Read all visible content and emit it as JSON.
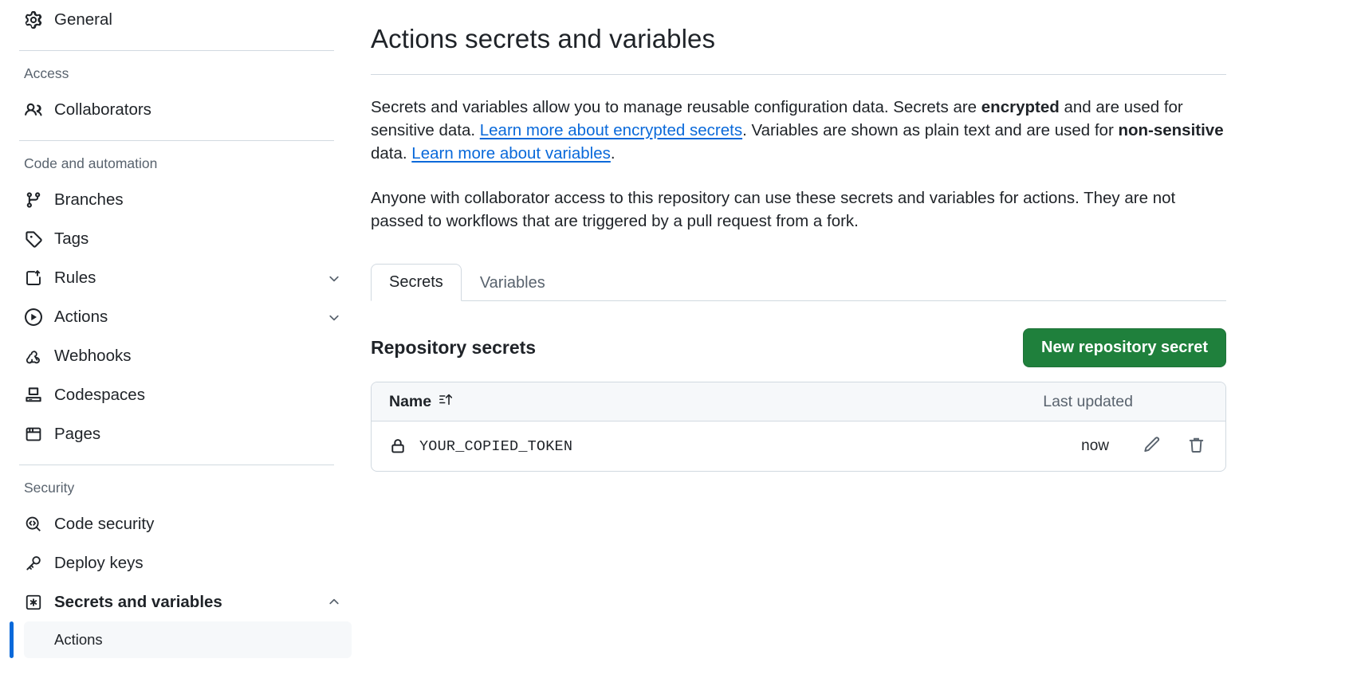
{
  "sidebar": {
    "top_items": [
      {
        "label": "General",
        "icon": "gear-icon"
      }
    ],
    "groups": [
      {
        "title": "Access",
        "items": [
          {
            "label": "Collaborators",
            "icon": "people-icon",
            "chevron": ""
          }
        ]
      },
      {
        "title": "Code and automation",
        "items": [
          {
            "label": "Branches",
            "icon": "git-branch-icon",
            "chevron": ""
          },
          {
            "label": "Tags",
            "icon": "tag-icon",
            "chevron": ""
          },
          {
            "label": "Rules",
            "icon": "rules-icon",
            "chevron": "down"
          },
          {
            "label": "Actions",
            "icon": "play-circle-icon",
            "chevron": "down"
          },
          {
            "label": "Webhooks",
            "icon": "webhook-icon",
            "chevron": ""
          },
          {
            "label": "Codespaces",
            "icon": "codespaces-icon",
            "chevron": ""
          },
          {
            "label": "Pages",
            "icon": "browser-icon",
            "chevron": ""
          }
        ]
      },
      {
        "title": "Security",
        "items": [
          {
            "label": "Code security",
            "icon": "code-scan-icon",
            "chevron": ""
          },
          {
            "label": "Deploy keys",
            "icon": "key-icon",
            "chevron": ""
          },
          {
            "label": "Secrets and variables",
            "icon": "asterisk-box-icon",
            "chevron": "up",
            "bold": true
          }
        ],
        "sub_items": [
          {
            "label": "Actions",
            "selected": true
          }
        ]
      }
    ]
  },
  "main": {
    "page_title": "Actions secrets and variables",
    "paragraph1": {
      "part1": "Secrets and variables allow you to manage reusable configuration data. Secrets are ",
      "bold1": "encrypted",
      "part2": " and are used for sensitive data. ",
      "link1": "Learn more about encrypted secrets",
      "part3": ". Variables are shown as plain text and are used for ",
      "bold2": "non-sensitive",
      "part4": " data. ",
      "link2": "Learn more about variables",
      "part5": "."
    },
    "paragraph2": "Anyone with collaborator access to this repository can use these secrets and variables for actions. They are not passed to workflows that are triggered by a pull request from a fork.",
    "tabs": [
      {
        "label": "Secrets",
        "active": true
      },
      {
        "label": "Variables",
        "active": false
      }
    ],
    "section": {
      "title": "Repository secrets",
      "new_button_label": "New repository secret"
    },
    "table": {
      "headers": {
        "name": "Name",
        "sort_icon": "sort-asc-icon",
        "last_updated": "Last updated"
      },
      "rows": [
        {
          "icon": "lock-icon",
          "name": "YOUR_COPIED_TOKEN",
          "last_updated": "now",
          "edit_icon": "pencil-icon",
          "delete_icon": "trash-icon"
        }
      ]
    }
  },
  "colors": {
    "accent_green": "#1f803c",
    "link_blue": "#0969da",
    "selected_bar": "#0969da",
    "border": "#d1d9e0",
    "muted_text": "#59636e",
    "header_bg": "#f6f8fa"
  }
}
